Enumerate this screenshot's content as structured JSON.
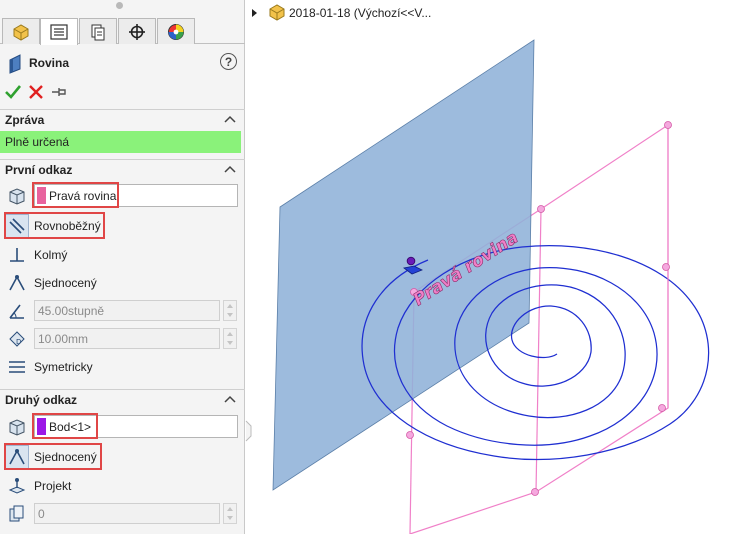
{
  "panel": {
    "title": "Rovina",
    "help_label": "?",
    "tabs": [
      {
        "icon": "part-icon",
        "active": false
      },
      {
        "icon": "property-manager-icon",
        "active": true
      },
      {
        "icon": "configuration-manager-icon",
        "active": false
      },
      {
        "icon": "dimxpert-icon",
        "active": false
      },
      {
        "icon": "display-manager-icon",
        "active": false
      }
    ],
    "actions": {
      "ok": "ok-icon",
      "cancel": "cancel-icon",
      "pin": "pin-icon"
    },
    "message_section": {
      "label": "Zpráva",
      "text": "Plně určená",
      "color": "#8af27a"
    },
    "first_reference": {
      "label": "První odkaz",
      "selection": "Pravá rovina",
      "selection_color": "#e8639e",
      "options": [
        "Rovnoběžný",
        "Kolmý",
        "Sjednocený"
      ],
      "angle": "45.00stupně",
      "distance": "10.00mm",
      "symmetric": "Symetricky"
    },
    "second_reference": {
      "label": "Druhý odkaz",
      "selection": "Bod<1>",
      "selection_color": "#9b18e6",
      "options": [
        "Sjednocený",
        "Projekt"
      ],
      "count": "0"
    }
  },
  "viewport": {
    "tree_item": "2018-01-18  (Výchozí<<V...",
    "plane_label": "Pravá rovina",
    "colors": {
      "plane": "#8fb2d8",
      "spiral": "#1f2fd1",
      "sketch": "#f080c8",
      "highlight": "#e04646"
    }
  }
}
